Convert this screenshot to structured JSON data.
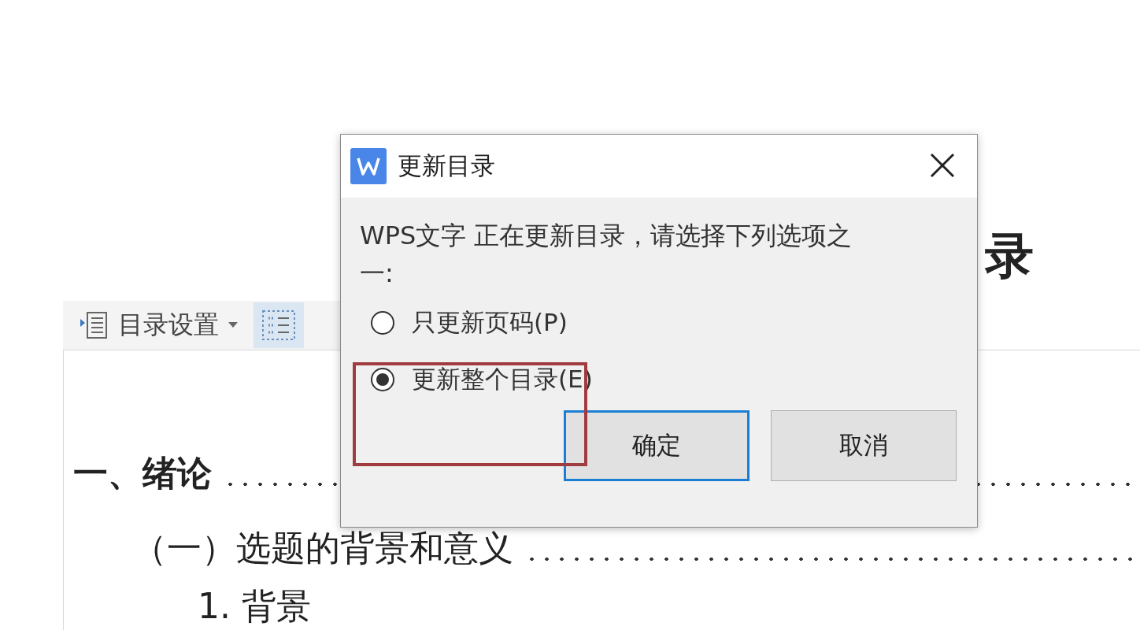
{
  "document": {
    "heading": "录",
    "toolbar": [
      {
        "kind": "menu",
        "label": "目录设置",
        "selected": false
      },
      {
        "kind": "icon",
        "selected": true
      }
    ],
    "entries": [
      {
        "text": "一、绪论",
        "children": [
          {
            "text": "（一）选题的背景和意义",
            "children": [
              {
                "text": "1. 背景"
              }
            ]
          }
        ]
      }
    ]
  },
  "dialog": {
    "title": "更新目录",
    "message": "WPS文字 正在更新目录，请选择下列选项之一:",
    "options": [
      {
        "label": "只更新页码(P)",
        "selected": false
      },
      {
        "label": "更新整个目录(E)",
        "selected": true
      }
    ],
    "buttons": [
      {
        "label": "确定",
        "focused": true
      },
      {
        "label": "取消",
        "focused": false
      }
    ]
  }
}
